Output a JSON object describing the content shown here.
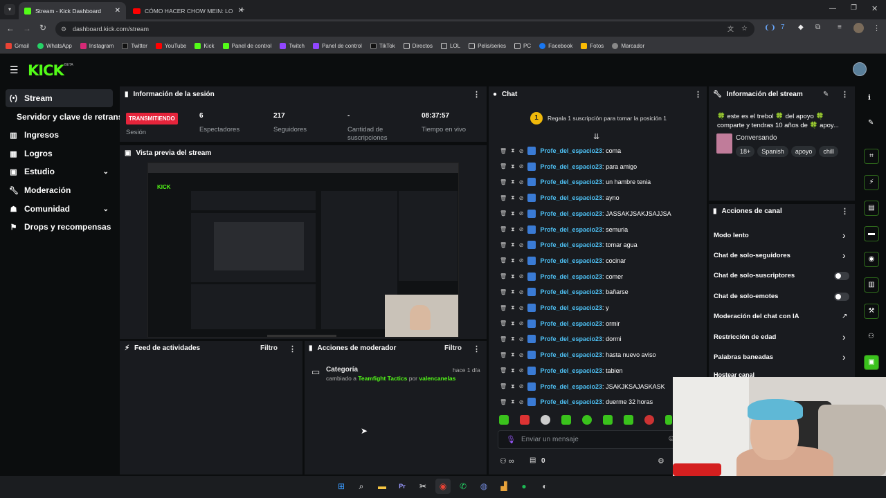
{
  "browser": {
    "tabs": [
      {
        "label": "Stream - Kick Dashboard",
        "active": true
      },
      {
        "label": "CÓMO HACER CHOW MEIN: LO",
        "active": false
      }
    ],
    "url": "dashboard.kick.com/stream",
    "bookmarks": [
      "Gmail",
      "WhatsApp",
      "Instagram",
      "Twitter",
      "YouTube",
      "Kick",
      "Panel de control",
      "Twitch",
      "Panel de control",
      "TikTok",
      "Directos",
      "LOL",
      "Pelis/series",
      "PC",
      "Facebook",
      "Fotos",
      "Marcador"
    ]
  },
  "app": {
    "logo": "KICK",
    "beta": "BETA"
  },
  "sidebar": {
    "items": [
      {
        "label": "Stream",
        "icon": "broadcast-icon",
        "active": true
      },
      {
        "label": "Servidor y clave de retransm",
        "icon": "",
        "active": false
      },
      {
        "label": "Ingresos",
        "icon": "chart-icon",
        "active": false
      },
      {
        "label": "Logros",
        "icon": "trophy-icon",
        "active": false
      },
      {
        "label": "Estudio",
        "icon": "studio-icon",
        "active": false
      },
      {
        "label": "Moderación",
        "icon": "wrench-icon",
        "active": false
      },
      {
        "label": "Comunidad",
        "icon": "community-icon",
        "active": false
      },
      {
        "label": "Drops y recompensas",
        "icon": "drops-icon",
        "active": false
      }
    ]
  },
  "session": {
    "title": "Información de la sesión",
    "status": "TRANSMITIENDO",
    "status_label": "Sesión",
    "viewers": "6",
    "viewers_label": "Espectadores",
    "followers": "217",
    "followers_label": "Seguidores",
    "subs": "-",
    "subs_label": "Cantidad de suscripciones",
    "uptime": "08:37:57",
    "uptime_label": "Tiempo en vivo"
  },
  "preview": {
    "title": "Vista previa del stream"
  },
  "feed": {
    "title": "Feed de actividades",
    "filter": "Filtro"
  },
  "modactions": {
    "title": "Acciones de moderador",
    "filter": "Filtro",
    "entry_title": "Categoría",
    "entry_time": "hace 1 día",
    "entry_prefix": "cambiado a",
    "entry_category": "Teamfight Tactics",
    "entry_by": "por",
    "entry_user": "valencanelas"
  },
  "chat": {
    "title": "Chat",
    "gift_rank": "1",
    "gift_text": "Regala 1 suscripción para tomar la posición 1",
    "messages": [
      {
        "user": "Profe_del_espacio23",
        "text": "coma"
      },
      {
        "user": "Profe_del_espacio23",
        "text": "para amigo"
      },
      {
        "user": "Profe_del_espacio23",
        "text": "un hambre tenia"
      },
      {
        "user": "Profe_del_espacio23",
        "text": "ayno"
      },
      {
        "user": "Profe_del_espacio23",
        "text": "JASSAKJSAKJSAJJSA"
      },
      {
        "user": "Profe_del_espacio23",
        "text": "semuria"
      },
      {
        "user": "Profe_del_espacio23",
        "text": "tomar agua"
      },
      {
        "user": "Profe_del_espacio23",
        "text": "cocinar"
      },
      {
        "user": "Profe_del_espacio23",
        "text": "comer"
      },
      {
        "user": "Profe_del_espacio23",
        "text": "bañarse"
      },
      {
        "user": "Profe_del_espacio23",
        "text": "y"
      },
      {
        "user": "Profe_del_espacio23",
        "text": "ormir"
      },
      {
        "user": "Profe_del_espacio23",
        "text": "dormi"
      },
      {
        "user": "Profe_del_espacio23",
        "text": "hasta nuevo aviso"
      },
      {
        "user": "Profe_del_espacio23",
        "text": "tabien"
      },
      {
        "user": "Profe_del_espacio23",
        "text": "JSAKJKSAJASKASK"
      },
      {
        "user": "Profe_del_espacio23",
        "text": "duerme 32 horas"
      }
    ],
    "input_placeholder": "Enviar un mensaje",
    "points": "0"
  },
  "streaminfo": {
    "title": "Información del stream",
    "line1": "🍀 este es el trebol 🍀 del apoyo 🍀",
    "line2": "comparte y tendras 10 años de 🍀 apoy...",
    "category": "Conversando",
    "tags": [
      "18+",
      "Spanish",
      "apoyo",
      "chill"
    ]
  },
  "channel_actions": {
    "title": "Acciones de canal",
    "items": [
      {
        "label": "Modo lento"
      },
      {
        "label": "Chat de solo-seguidores"
      },
      {
        "label": "Chat de solo-suscriptores"
      },
      {
        "label": "Chat de solo-emotes"
      },
      {
        "label": "Moderación del chat con IA"
      },
      {
        "label": "Restricción de edad"
      },
      {
        "label": "Palabras baneadas"
      },
      {
        "label": "Hostear canal"
      }
    ]
  },
  "colors": {
    "accent": "#53fc18",
    "live": "#e5243b",
    "username": "#4fc3f7"
  }
}
